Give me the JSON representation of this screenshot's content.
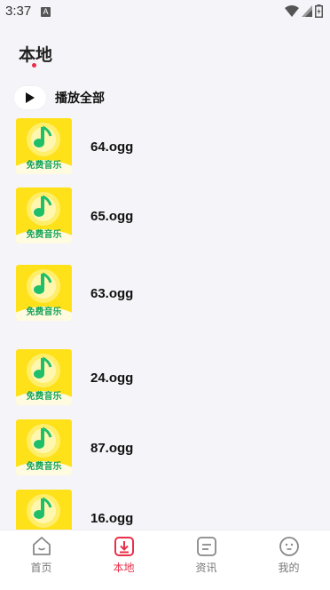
{
  "status_bar": {
    "time": "3:37",
    "notification_glyph": "A"
  },
  "header": {
    "title": "本地"
  },
  "play_all": {
    "label": "播放全部"
  },
  "cover_caption": "免费音乐",
  "songs": [
    {
      "name": "64.ogg"
    },
    {
      "name": "65.ogg"
    },
    {
      "name": "63.ogg"
    },
    {
      "name": "24.ogg"
    },
    {
      "name": "87.ogg"
    },
    {
      "name": "16.ogg"
    }
  ],
  "tabs": [
    {
      "label": "首页",
      "icon": "home-face-icon",
      "active": false
    },
    {
      "label": "本地",
      "icon": "download-icon",
      "active": true
    },
    {
      "label": "资讯",
      "icon": "news-icon",
      "active": false
    },
    {
      "label": "我的",
      "icon": "profile-face-icon",
      "active": false
    }
  ],
  "colors": {
    "accent": "#e8304a",
    "cover_bg": "#ffe11a",
    "note": "#1fbf6a",
    "background": "#f5f5f9"
  }
}
